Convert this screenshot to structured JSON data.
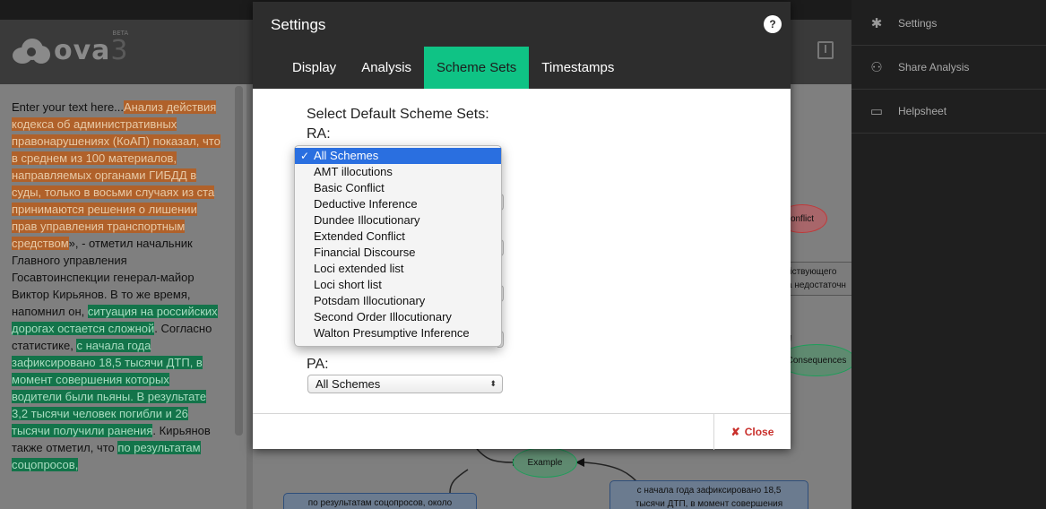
{
  "app": {
    "logo_text": "ova",
    "logo_version": "3",
    "logo_badge": "BETA"
  },
  "text_panel": {
    "segments": [
      {
        "text": "Enter your text here...",
        "style": "plain"
      },
      {
        "text": "Анализ действия кодекса об административных правонарушениях (КоАП) показал, что в среднем из 100 материалов, направляемых органами ГИБДД в суды, только в восьми случаях из ста принимаются решения о лишении прав управления транспортным средством",
        "style": "orange"
      },
      {
        "text": "», - отметил начальник Главного управления Госавтоинспекции генерал-майор Виктор Кирьянов. В то же время, напомнил он, ",
        "style": "plain"
      },
      {
        "text": "ситуация на российских дорогах остается сложной",
        "style": "green"
      },
      {
        "text": ". Согласно статистике, ",
        "style": "plain"
      },
      {
        "text": "с начала года зафиксировано 18,5 тысячи ДТП, в момент совершения которых водители были пьяны. В результате 3,2 тысячи человек погибли и 26 тысячи получили ранения",
        "style": "green"
      },
      {
        "text": ". Кирьянов также отметил, что ",
        "style": "plain"
      },
      {
        "text": "по результатам соцопросов,",
        "style": "green"
      }
    ]
  },
  "canvas": {
    "node_conflict": "onflict",
    "box_right_top_1": "йствующего",
    "box_right_top_2": "а недостаточн",
    "node_consequences": "Consequences",
    "node_example": "Example",
    "box_bottom_left": "по результатам соцопросов, около",
    "box_bottom_right_1": "с начала года зафиксировано 18,5",
    "box_bottom_right_2": "тысячи ДТП, в момент совершения"
  },
  "sidebar": {
    "items": [
      {
        "label": "Settings",
        "icon": "gear-icon"
      },
      {
        "label": "Share Analysis",
        "icon": "users-icon"
      },
      {
        "label": "Helpsheet",
        "icon": "comment-icon"
      }
    ]
  },
  "modal": {
    "title": "Settings",
    "help": "?",
    "tabs": [
      {
        "label": "Display",
        "active": false
      },
      {
        "label": "Analysis",
        "active": false
      },
      {
        "label": "Scheme Sets",
        "active": true
      },
      {
        "label": "Timestamps",
        "active": false
      }
    ],
    "heading": "Select Default Scheme Sets:",
    "ra_label": "RA:",
    "pa_label": "PA:",
    "pa_value": "All Schemes",
    "dropdown": {
      "check": "✓",
      "selected": "All Schemes",
      "options": [
        "All Schemes",
        "AMT illocutions",
        "Basic Conflict",
        "Deductive Inference",
        "Dundee Illocutionary",
        "Extended Conflict",
        "Financial Discourse",
        "Loci extended list",
        "Loci short list",
        "Potsdam Illocutionary",
        "Second Order Illocutionary",
        "Walton Presumptive Inference"
      ]
    },
    "close_label": "Close",
    "close_icon": "✘"
  },
  "colors": {
    "accent_tab": "#0fc385",
    "highlight_orange": "#b0612a",
    "highlight_green": "#13744a",
    "close_red": "#c9302c",
    "selection_blue": "#2a6fe0"
  }
}
